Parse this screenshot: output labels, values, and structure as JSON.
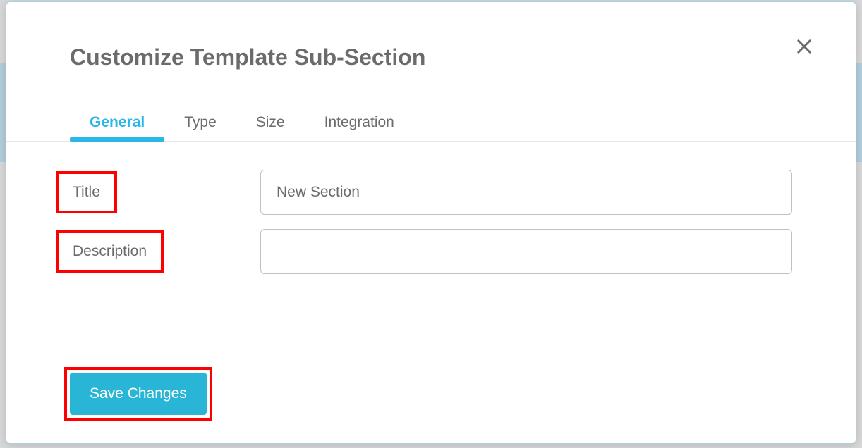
{
  "modal": {
    "title": "Customize Template Sub-Section",
    "tabs": [
      {
        "label": "General",
        "active": true
      },
      {
        "label": "Type",
        "active": false
      },
      {
        "label": "Size",
        "active": false
      },
      {
        "label": "Integration",
        "active": false
      }
    ],
    "form": {
      "title_label": "Title",
      "title_value": "New Section",
      "description_label": "Description",
      "description_value": ""
    },
    "footer": {
      "save_label": "Save Changes"
    }
  }
}
